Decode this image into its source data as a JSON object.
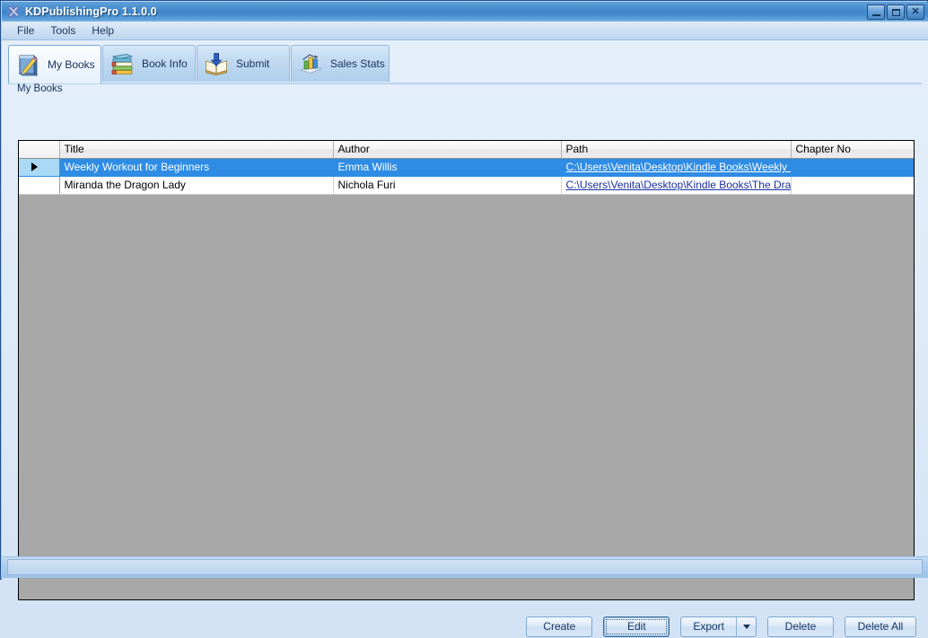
{
  "window": {
    "title": "KDPublishingPro 1.1.0.0",
    "app_icon": "app-logo-icon",
    "minimize_label": "Minimize",
    "maximize_label": "Maximize",
    "close_label": "Close",
    "close_glyph": "✕"
  },
  "menu": {
    "items": [
      {
        "label": "File"
      },
      {
        "label": "Tools"
      },
      {
        "label": "Help"
      }
    ]
  },
  "tabs": [
    {
      "label": "My Books",
      "icon": "book-pencil-icon",
      "selected": true
    },
    {
      "label": "Book Info",
      "icon": "book-stack-icon",
      "selected": false
    },
    {
      "label": "Submit",
      "icon": "open-book-download-icon",
      "selected": false
    },
    {
      "label": "Sales Stats",
      "icon": "bar-chart-icon",
      "selected": false
    }
  ],
  "group": {
    "caption": "My Books"
  },
  "grid": {
    "columns": [
      {
        "key": "selector",
        "label": ""
      },
      {
        "key": "title",
        "label": "Title"
      },
      {
        "key": "author",
        "label": "Author"
      },
      {
        "key": "path",
        "label": "Path"
      },
      {
        "key": "chapter",
        "label": "Chapter No"
      }
    ],
    "rows": [
      {
        "selected": true,
        "marker": "▶",
        "title": "Weekly Workout for Beginners",
        "author": "Emma Willis",
        "path": "C:\\Users\\Venita\\Desktop\\Kindle Books\\Weekly ...",
        "chapter": ""
      },
      {
        "selected": false,
        "marker": "",
        "title": "Miranda the Dragon Lady",
        "author": "Nichola Furi",
        "path": "C:\\Users\\Venita\\Desktop\\Kindle Books\\The Drag...",
        "chapter": ""
      }
    ]
  },
  "buttons": {
    "create": "Create",
    "edit": "Edit",
    "export": "Export",
    "export_arrow": "chevron-down-icon",
    "delete": "Delete",
    "delete_all": "Delete All"
  },
  "colors": {
    "title_bar": "#4a90d0",
    "selection": "#2e8ce4",
    "selector_cell": "#a9d9f5",
    "grid_empty": "#a8a8a8",
    "link": "#1a2fa0",
    "client": "#dfeaf8",
    "text": "#17325a"
  }
}
